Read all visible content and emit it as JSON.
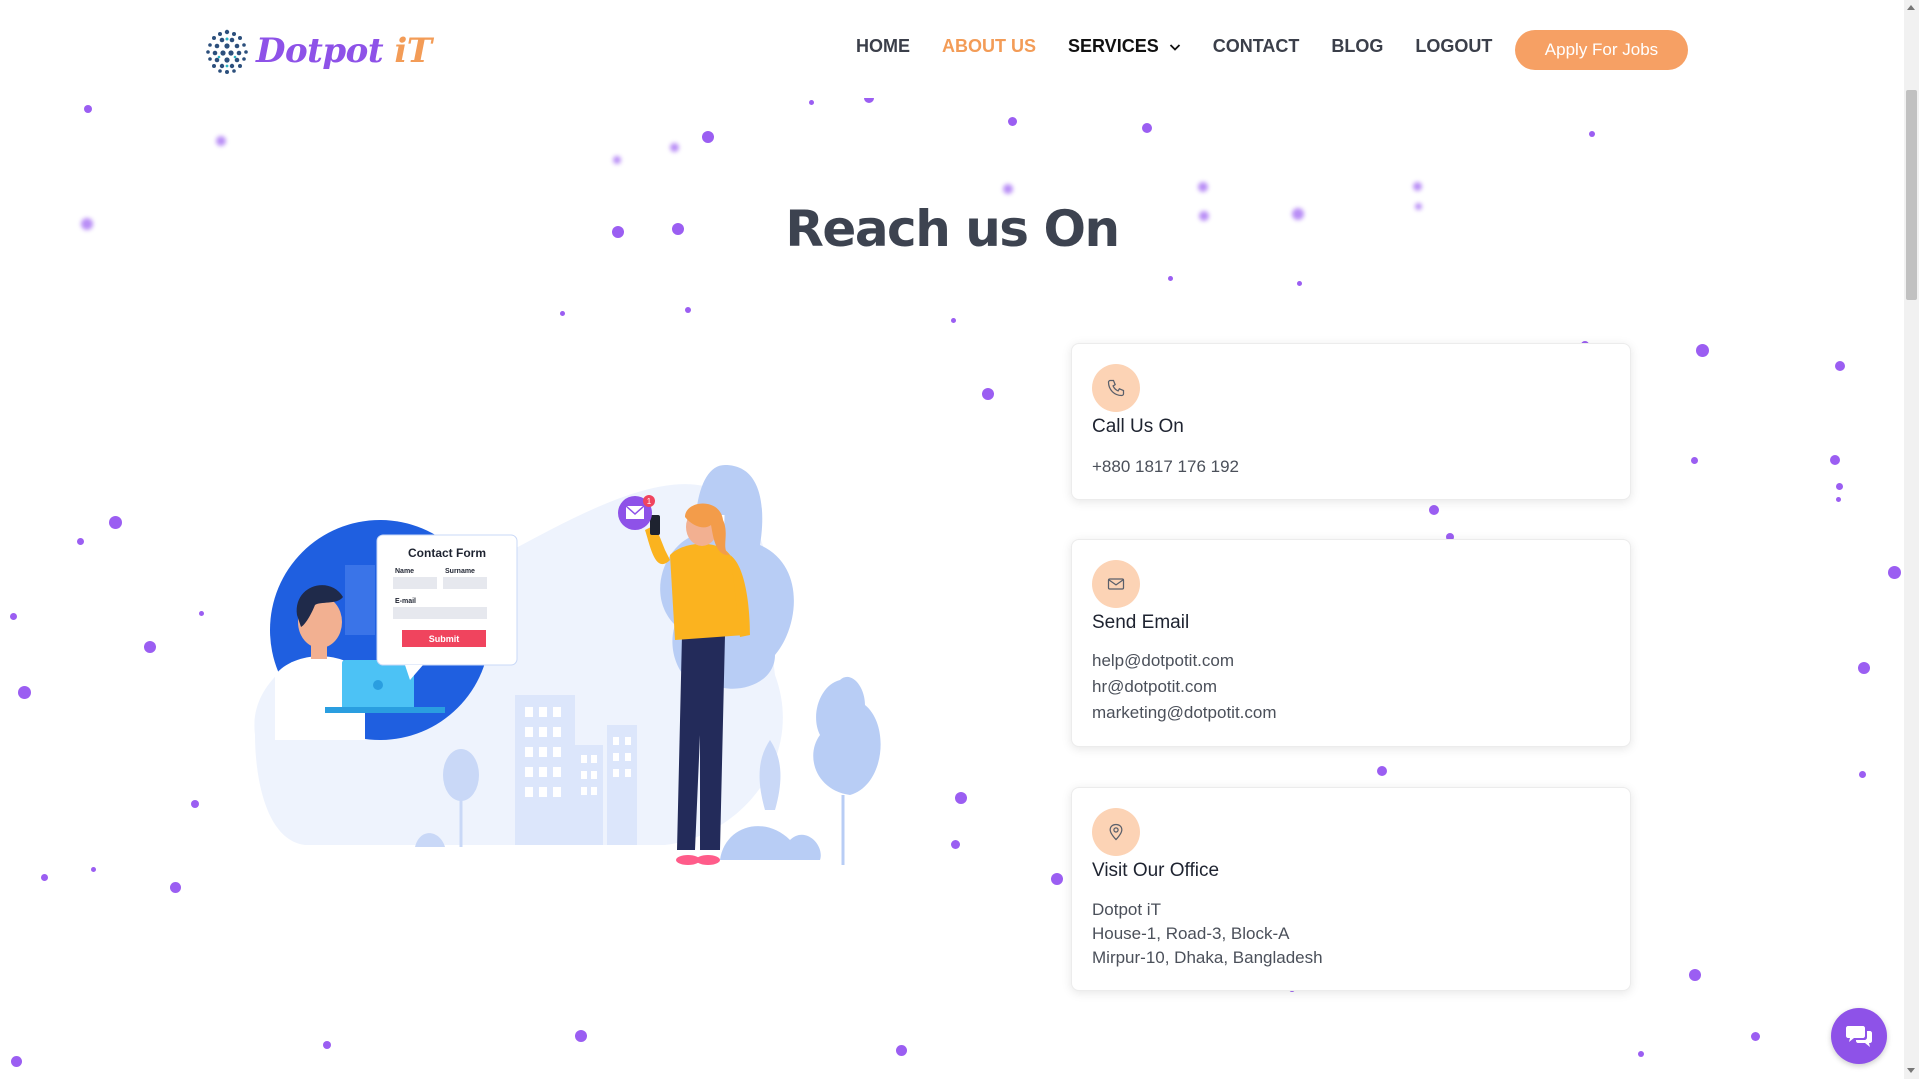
{
  "brand": {
    "logo_part1": "Dotpot ",
    "logo_part2": "iT"
  },
  "nav": {
    "items": [
      {
        "label": "HOME",
        "active": false
      },
      {
        "label": "ABOUT US",
        "active": true
      },
      {
        "label": "SERVICES",
        "active": false,
        "has_dropdown": true
      },
      {
        "label": "CONTACT",
        "active": false
      },
      {
        "label": "BLOG",
        "active": false
      },
      {
        "label": "LOGOUT",
        "active": false
      }
    ],
    "apply_label": "Apply For Jobs"
  },
  "page": {
    "title": "Reach us On"
  },
  "illustration": {
    "form_title": "Contact Form",
    "field_name": "Name",
    "field_surname": "Surname",
    "field_email": "E-mail",
    "submit": "Submit",
    "notification_count": "1"
  },
  "contact_cards": [
    {
      "icon": "phone-icon",
      "title": "Call Us On",
      "lines": [
        "+880 1817 176 192"
      ]
    },
    {
      "icon": "mail-icon",
      "title": "Send Email",
      "lines": [
        "help@dotpotit.com",
        "hr@dotpotit.com",
        "marketing@dotpotit.com"
      ]
    },
    {
      "icon": "location-pin-icon",
      "title": "Visit Our Office",
      "lines": [
        "Dotpot iT",
        "House-1, Road-3, Block-A",
        "Mirpur-10, Dhaka, Bangladesh"
      ]
    }
  ],
  "colors": {
    "accent_orange": "#f39c57",
    "accent_purple": "#8e52e8",
    "icon_bg": "#fcd3b5"
  }
}
